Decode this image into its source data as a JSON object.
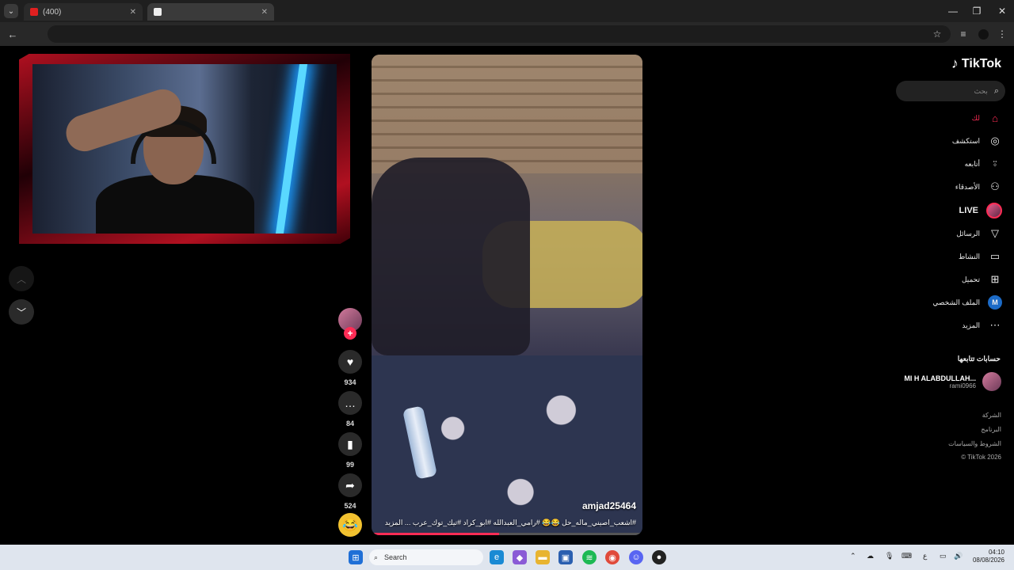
{
  "browser": {
    "tab1_label": "(400) ",
    "tab2_label": ""
  },
  "video": {
    "username": "amjad25464",
    "caption": "#اشعب_اصيني_ماله_حل 😂😂 #رامي_العبدالله #ابو_كراد #تيك_توك_عرب ...  المزيد",
    "progress": 0.47
  },
  "actions": {
    "likes": "934",
    "comments": "84",
    "saves": "99",
    "shares": "524"
  },
  "sidebar": {
    "logo": "TikTok",
    "search_placeholder": "بحث",
    "nav": [
      {
        "label": "لك",
        "icon": "home-icon"
      },
      {
        "label": "استكشف",
        "icon": "compass-icon"
      },
      {
        "label": "أتابعه",
        "icon": "user-plus-icon"
      },
      {
        "label": "الأصدقاء",
        "icon": "friends-icon"
      },
      {
        "label": "LIVE",
        "icon": "live-icon"
      },
      {
        "label": "الرسائل",
        "icon": "messages-icon"
      },
      {
        "label": "النشاط",
        "icon": "activity-icon"
      },
      {
        "label": "تحميل",
        "icon": "upload-icon"
      },
      {
        "label": "الملف الشخصي",
        "icon": "profile-icon"
      },
      {
        "label": "المزيد",
        "icon": "more-icon"
      }
    ],
    "profile_initial": "M",
    "following_title": "حسابات تتابعها",
    "account_name": "MI H ALABDULLAH...",
    "account_handle": "rami0966",
    "footer": [
      "الشركة",
      "البرنامج",
      "الشروط والسياسات",
      "© TikTok 2026"
    ]
  },
  "taskbar": {
    "search_label": "Search",
    "time": "04:10",
    "date": "08/08/2026",
    "lang": "ع"
  }
}
